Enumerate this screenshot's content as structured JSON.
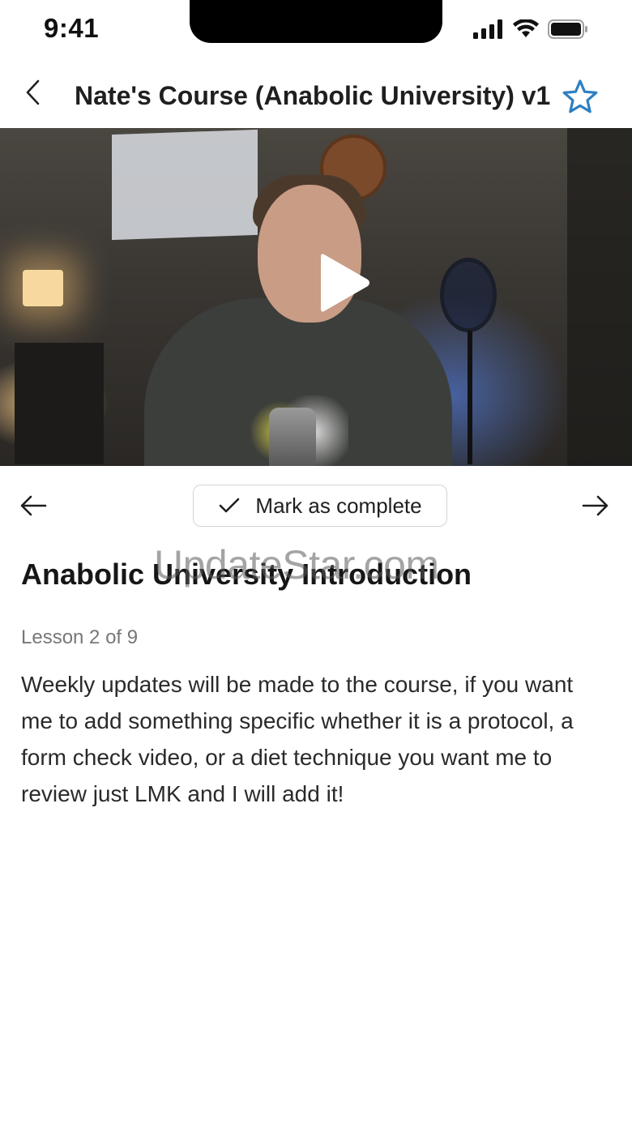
{
  "status_bar": {
    "time": "9:41"
  },
  "header": {
    "title": "Nate's Course (Anabolic University) v1",
    "back_icon": "chevron-left-icon",
    "favorite_icon": "star-outline-icon",
    "accent_color": "#2D7FC1"
  },
  "video": {
    "play_icon": "play-icon"
  },
  "lesson_nav": {
    "prev_icon": "arrow-left-icon",
    "next_icon": "arrow-right-icon",
    "complete_label": "Mark as complete",
    "check_icon": "check-icon"
  },
  "lesson": {
    "title": "Anabolic University Introduction",
    "counter": "Lesson 2 of 9",
    "description": "Weekly updates will be made to the course, if you want me to add something specific whether it is a protocol, a form check video, or a diet technique you want me to review just LMK and I will add it!"
  },
  "watermark": {
    "text": "UpdateStar.com"
  }
}
